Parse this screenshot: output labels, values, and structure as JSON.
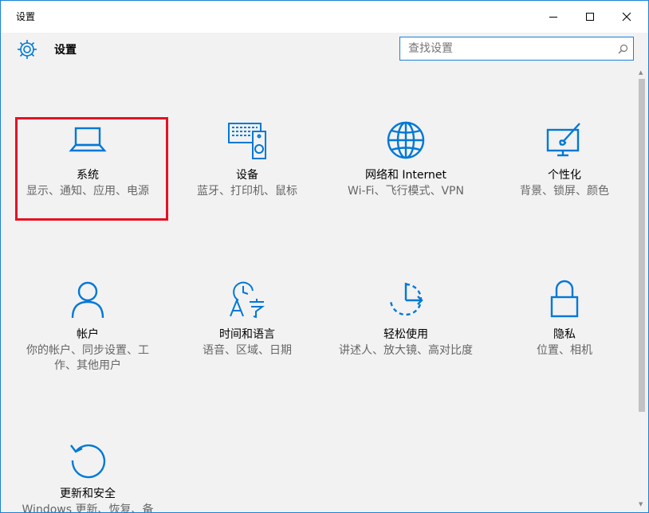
{
  "window": {
    "title": "设置"
  },
  "header": {
    "title": "设置"
  },
  "search": {
    "placeholder": "查找设置",
    "value": ""
  },
  "tiles": [
    {
      "name": "系统",
      "desc": "显示、通知、应用、电源",
      "icon": "laptop-icon"
    },
    {
      "name": "设备",
      "desc": "蓝牙、打印机、鼠标",
      "icon": "devices-icon"
    },
    {
      "name": "网络和 Internet",
      "desc": "Wi-Fi、飞行模式、VPN",
      "icon": "globe-icon"
    },
    {
      "name": "个性化",
      "desc": "背景、锁屏、颜色",
      "icon": "personalization-icon"
    },
    {
      "name": "帐户",
      "desc": "你的帐户、同步设置、工作、其他用户",
      "icon": "person-icon"
    },
    {
      "name": "时间和语言",
      "desc": "语音、区域、日期",
      "icon": "time-language-icon"
    },
    {
      "name": "轻松使用",
      "desc": "讲述人、放大镜、高对比度",
      "icon": "ease-of-access-icon"
    },
    {
      "name": "隐私",
      "desc": "位置、相机",
      "icon": "lock-icon"
    },
    {
      "name": "更新和安全",
      "desc": "Windows 更新、恢复、备份",
      "icon": "update-icon"
    }
  ],
  "colors": {
    "accent": "#0078d7",
    "highlight": "#e81123",
    "background": "#f2f2f2"
  }
}
